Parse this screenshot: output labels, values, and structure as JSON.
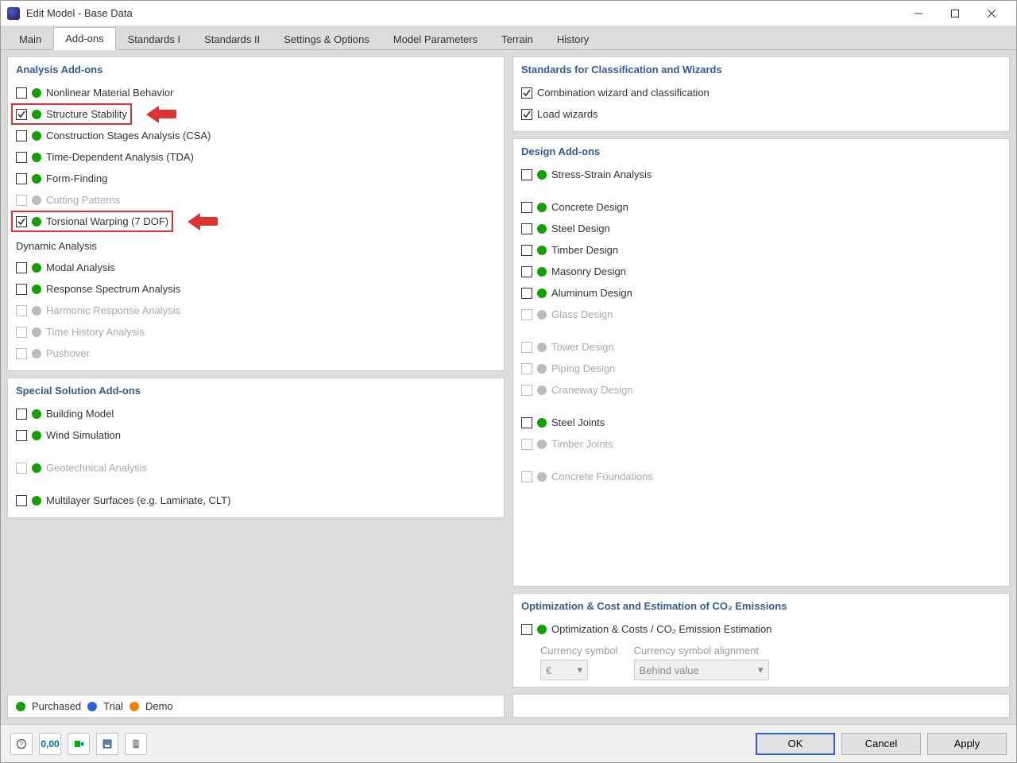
{
  "window": {
    "title": "Edit Model - Base Data"
  },
  "tabs": {
    "main": "Main",
    "addons": "Add-ons",
    "std1": "Standards I",
    "std2": "Standards II",
    "settings": "Settings & Options",
    "modelparams": "Model Parameters",
    "terrain": "Terrain",
    "history": "History",
    "active": "addons"
  },
  "panels": {
    "analysis": {
      "title": "Analysis Add-ons",
      "items": [
        {
          "label": "Nonlinear Material Behavior",
          "checked": false,
          "dot": "green",
          "disabled": false
        },
        {
          "label": "Structure Stability",
          "checked": true,
          "dot": "green",
          "disabled": false,
          "highlighted": true
        },
        {
          "label": "Construction Stages Analysis (CSA)",
          "checked": false,
          "dot": "green",
          "disabled": false
        },
        {
          "label": "Time-Dependent Analysis (TDA)",
          "checked": false,
          "dot": "green",
          "disabled": false
        },
        {
          "label": "Form-Finding",
          "checked": false,
          "dot": "green",
          "disabled": false
        },
        {
          "label": "Cutting Patterns",
          "checked": false,
          "dot": "grey",
          "disabled": true
        },
        {
          "label": "Torsional Warping (7 DOF)",
          "checked": true,
          "dot": "green",
          "disabled": false,
          "highlighted": true
        }
      ],
      "dynamic_title": "Dynamic Analysis",
      "dynamic_items": [
        {
          "label": "Modal Analysis",
          "checked": false,
          "dot": "green",
          "disabled": false
        },
        {
          "label": "Response Spectrum Analysis",
          "checked": false,
          "dot": "green",
          "disabled": false
        },
        {
          "label": "Harmonic Response Analysis",
          "checked": false,
          "dot": "grey",
          "disabled": true
        },
        {
          "label": "Time History Analysis",
          "checked": false,
          "dot": "grey",
          "disabled": true
        },
        {
          "label": "Pushover",
          "checked": false,
          "dot": "grey",
          "disabled": true
        }
      ]
    },
    "special": {
      "title": "Special Solution Add-ons",
      "group1": [
        {
          "label": "Building Model",
          "checked": false,
          "dot": "green",
          "disabled": false
        },
        {
          "label": "Wind Simulation",
          "checked": false,
          "dot": "green",
          "disabled": false
        }
      ],
      "group2": [
        {
          "label": "Geotechnical Analysis",
          "checked": false,
          "dot": "green",
          "disabled": true
        }
      ],
      "group3": [
        {
          "label": "Multilayer Surfaces (e.g. Laminate, CLT)",
          "checked": false,
          "dot": "green",
          "disabled": false
        }
      ]
    },
    "standards_wiz": {
      "title": "Standards for Classification and Wizards",
      "items": [
        {
          "label": "Combination wizard and classification",
          "checked": true
        },
        {
          "label": "Load wizards",
          "checked": true
        }
      ]
    },
    "design": {
      "title": "Design Add-ons",
      "group_a": [
        {
          "label": "Stress-Strain Analysis",
          "checked": false,
          "dot": "green",
          "disabled": false
        }
      ],
      "group_b": [
        {
          "label": "Concrete Design",
          "checked": false,
          "dot": "green",
          "disabled": false
        },
        {
          "label": "Steel Design",
          "checked": false,
          "dot": "green",
          "disabled": false
        },
        {
          "label": "Timber Design",
          "checked": false,
          "dot": "green",
          "disabled": false
        },
        {
          "label": "Masonry Design",
          "checked": false,
          "dot": "green",
          "disabled": false
        },
        {
          "label": "Aluminum Design",
          "checked": false,
          "dot": "green",
          "disabled": false
        },
        {
          "label": "Glass Design",
          "checked": false,
          "dot": "grey",
          "disabled": true
        }
      ],
      "group_c": [
        {
          "label": "Tower Design",
          "checked": false,
          "dot": "grey",
          "disabled": true
        },
        {
          "label": "Piping Design",
          "checked": false,
          "dot": "grey",
          "disabled": true
        },
        {
          "label": "Craneway Design",
          "checked": false,
          "dot": "grey",
          "disabled": true
        }
      ],
      "group_d": [
        {
          "label": "Steel Joints",
          "checked": false,
          "dot": "green",
          "disabled": false
        },
        {
          "label": "Timber Joints",
          "checked": false,
          "dot": "grey",
          "disabled": true
        }
      ],
      "group_e": [
        {
          "label": "Concrete Foundations",
          "checked": false,
          "dot": "grey",
          "disabled": true
        }
      ]
    },
    "optimization": {
      "title": "Optimization & Cost and Estimation of CO₂ Emissions",
      "item": {
        "label": "Optimization & Costs / CO₂ Emission Estimation",
        "checked": false,
        "dot": "green",
        "disabled": false
      },
      "currency_label": "Currency symbol",
      "currency_value": "€",
      "align_label": "Currency symbol alignment",
      "align_value": "Behind value"
    }
  },
  "legend": {
    "purchased": "Purchased",
    "trial": "Trial",
    "demo": "Demo"
  },
  "footer": {
    "ok": "OK",
    "cancel": "Cancel",
    "apply": "Apply"
  }
}
